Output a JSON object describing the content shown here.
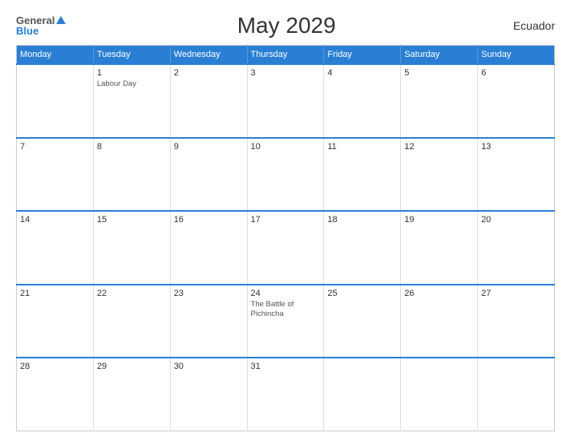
{
  "header": {
    "logo_general": "General",
    "logo_blue": "Blue",
    "title": "May 2029",
    "country": "Ecuador"
  },
  "calendar": {
    "days_of_week": [
      "Monday",
      "Tuesday",
      "Wednesday",
      "Thursday",
      "Friday",
      "Saturday",
      "Sunday"
    ],
    "weeks": [
      [
        {
          "day": "",
          "holiday": "",
          "empty": true
        },
        {
          "day": "1",
          "holiday": "Labour Day",
          "empty": false
        },
        {
          "day": "2",
          "holiday": "",
          "empty": false
        },
        {
          "day": "3",
          "holiday": "",
          "empty": false
        },
        {
          "day": "4",
          "holiday": "",
          "empty": false
        },
        {
          "day": "5",
          "holiday": "",
          "empty": false
        },
        {
          "day": "6",
          "holiday": "",
          "empty": false
        }
      ],
      [
        {
          "day": "7",
          "holiday": "",
          "empty": false
        },
        {
          "day": "8",
          "holiday": "",
          "empty": false
        },
        {
          "day": "9",
          "holiday": "",
          "empty": false
        },
        {
          "day": "10",
          "holiday": "",
          "empty": false
        },
        {
          "day": "11",
          "holiday": "",
          "empty": false
        },
        {
          "day": "12",
          "holiday": "",
          "empty": false
        },
        {
          "day": "13",
          "holiday": "",
          "empty": false
        }
      ],
      [
        {
          "day": "14",
          "holiday": "",
          "empty": false
        },
        {
          "day": "15",
          "holiday": "",
          "empty": false
        },
        {
          "day": "16",
          "holiday": "",
          "empty": false
        },
        {
          "day": "17",
          "holiday": "",
          "empty": false
        },
        {
          "day": "18",
          "holiday": "",
          "empty": false
        },
        {
          "day": "19",
          "holiday": "",
          "empty": false
        },
        {
          "day": "20",
          "holiday": "",
          "empty": false
        }
      ],
      [
        {
          "day": "21",
          "holiday": "",
          "empty": false
        },
        {
          "day": "22",
          "holiday": "",
          "empty": false
        },
        {
          "day": "23",
          "holiday": "",
          "empty": false
        },
        {
          "day": "24",
          "holiday": "The Battle of Pichincha",
          "empty": false
        },
        {
          "day": "25",
          "holiday": "",
          "empty": false
        },
        {
          "day": "26",
          "holiday": "",
          "empty": false
        },
        {
          "day": "27",
          "holiday": "",
          "empty": false
        }
      ],
      [
        {
          "day": "28",
          "holiday": "",
          "empty": false
        },
        {
          "day": "29",
          "holiday": "",
          "empty": false
        },
        {
          "day": "30",
          "holiday": "",
          "empty": false
        },
        {
          "day": "31",
          "holiday": "",
          "empty": false
        },
        {
          "day": "",
          "holiday": "",
          "empty": true
        },
        {
          "day": "",
          "holiday": "",
          "empty": true
        },
        {
          "day": "",
          "holiday": "",
          "empty": true
        }
      ]
    ]
  }
}
